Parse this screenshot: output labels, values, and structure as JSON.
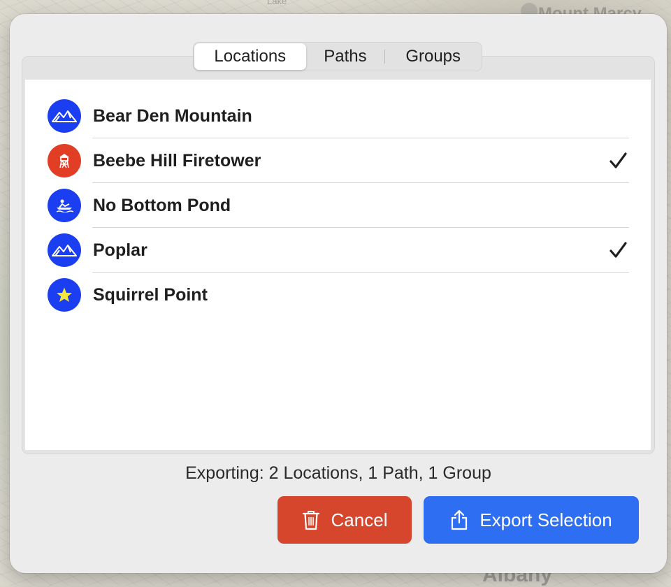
{
  "map": {
    "labels": {
      "mount": "Mount Marcy",
      "albany": "Albany",
      "lake": "Lake"
    }
  },
  "tabs": [
    {
      "label": "Locations",
      "active": true
    },
    {
      "label": "Paths",
      "active": false
    },
    {
      "label": "Groups",
      "active": false
    }
  ],
  "locations": [
    {
      "name": "Bear Den Mountain",
      "icon": "mountain-icon",
      "color": "#1a3ef0",
      "checked": false
    },
    {
      "name": "Beebe Hill Firetower",
      "icon": "firetower-icon",
      "color": "#e23e25",
      "checked": true
    },
    {
      "name": "No Bottom Pond",
      "icon": "kayak-icon",
      "color": "#1a3ef0",
      "checked": false
    },
    {
      "name": "Poplar",
      "icon": "mountain-icon",
      "color": "#1a3ef0",
      "checked": true
    },
    {
      "name": "Squirrel Point",
      "icon": "star-icon",
      "color": "#1a3ef0",
      "checked": false
    }
  ],
  "summary": "Exporting: 2 Locations, 1 Path, 1 Group",
  "buttons": {
    "cancel": {
      "label": "Cancel",
      "icon": "trash-icon",
      "color": "#d5462c"
    },
    "export": {
      "label": "Export Selection",
      "icon": "share-icon",
      "color": "#2e6ef2"
    }
  }
}
